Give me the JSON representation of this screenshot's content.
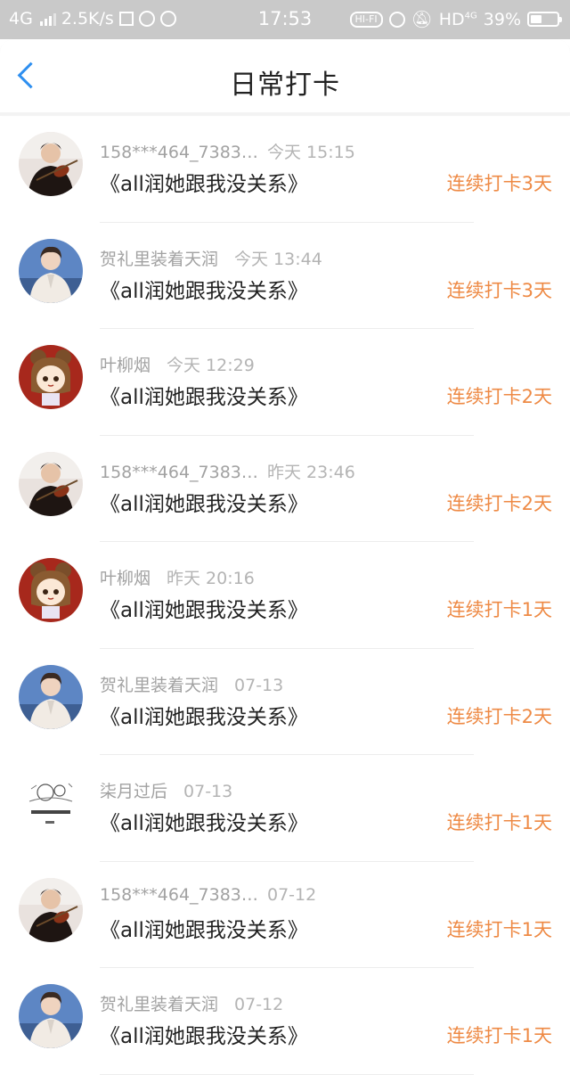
{
  "status_bar": {
    "network": "4G",
    "speed": "2.5K/s",
    "time": "17:53",
    "hifi": "HI-FI",
    "hd": "HD",
    "hd_sup": "4G",
    "battery": "39%"
  },
  "nav": {
    "back_icon": "chevron-left-icon",
    "title": "日常打卡",
    "accent": "#2e8ff0"
  },
  "colors": {
    "streak": "#ee8a45",
    "meta": "#a2a2a2",
    "book": "#222222"
  },
  "entries": [
    {
      "name": "158***464_7383…",
      "time": "今天 15:15",
      "book": "《all润她跟我没关系》",
      "streak": "连续打卡3天",
      "avatar": "violin"
    },
    {
      "name": "贺礼里装着天润",
      "time": "今天 13:44",
      "book": "《all润她跟我没关系》",
      "streak": "连续打卡3天",
      "avatar": "suit"
    },
    {
      "name": "叶柳烟",
      "time": "今天 12:29",
      "book": "《all润她跟我没关系》",
      "streak": "连续打卡2天",
      "avatar": "cartoon"
    },
    {
      "name": "158***464_7383…",
      "time": "昨天 23:46",
      "book": "《all润她跟我没关系》",
      "streak": "连续打卡2天",
      "avatar": "violin"
    },
    {
      "name": "叶柳烟",
      "time": "昨天 20:16",
      "book": "《all润她跟我没关系》",
      "streak": "连续打卡1天",
      "avatar": "cartoon"
    },
    {
      "name": "贺礼里装着天润",
      "time": "07-13",
      "book": "《all润她跟我没关系》",
      "streak": "连续打卡2天",
      "avatar": "suit"
    },
    {
      "name": "柒月过后",
      "time": "07-13",
      "book": "《all润她跟我没关系》",
      "streak": "连续打卡1天",
      "avatar": "sketch"
    },
    {
      "name": "158***464_7383…",
      "time": "07-12",
      "book": "《all润她跟我没关系》",
      "streak": "连续打卡1天",
      "avatar": "violin"
    },
    {
      "name": "贺礼里装着天润",
      "time": "07-12",
      "book": "《all润她跟我没关系》",
      "streak": "连续打卡1天",
      "avatar": "suit"
    }
  ]
}
